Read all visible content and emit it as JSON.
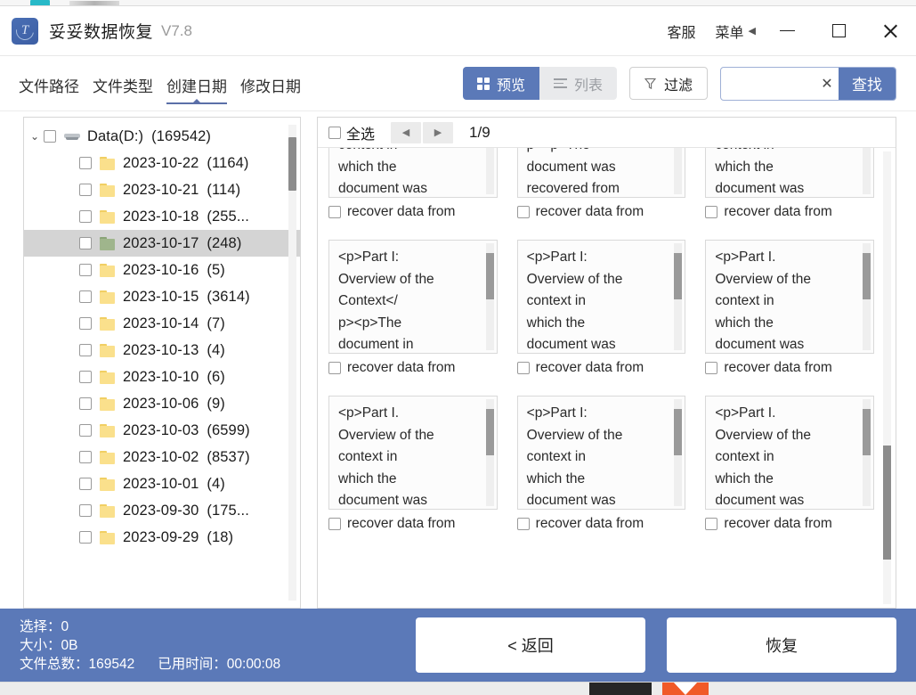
{
  "titlebar": {
    "app_name": "妥妥数据恢复",
    "version": "V7.8",
    "support_label": "客服",
    "menu_label": "菜单",
    "menu_caret": "◀",
    "minimize": "—",
    "maximize": "□",
    "close": "✕"
  },
  "toolbar": {
    "tabs": [
      {
        "label": "文件路径",
        "active": false
      },
      {
        "label": "文件类型",
        "active": false
      },
      {
        "label": "创建日期",
        "active": true
      },
      {
        "label": "修改日期",
        "active": false
      }
    ],
    "view_preview": "预览",
    "view_list": "列表",
    "filter_label": "过滤",
    "search_value": "",
    "search_placeholder": "",
    "search_clear": "✕",
    "search_button": "查找"
  },
  "tree": {
    "root": {
      "chevron": "⌄",
      "label": "Data(D:)",
      "count": "(169542)"
    },
    "items": [
      {
        "label": "2023-10-22",
        "count": "(1164)",
        "selected": false
      },
      {
        "label": "2023-10-21",
        "count": "(114)",
        "selected": false
      },
      {
        "label": "2023-10-18",
        "count": "(255...",
        "selected": false
      },
      {
        "label": "2023-10-17",
        "count": "(248)",
        "selected": true
      },
      {
        "label": "2023-10-16",
        "count": "(5)",
        "selected": false
      },
      {
        "label": "2023-10-15",
        "count": "(3614)",
        "selected": false
      },
      {
        "label": "2023-10-14",
        "count": "(7)",
        "selected": false
      },
      {
        "label": "2023-10-13",
        "count": "(4)",
        "selected": false
      },
      {
        "label": "2023-10-10",
        "count": "(6)",
        "selected": false
      },
      {
        "label": "2023-10-06",
        "count": "(9)",
        "selected": false
      },
      {
        "label": "2023-10-03",
        "count": "(6599)",
        "selected": false
      },
      {
        "label": "2023-10-02",
        "count": "(8537)",
        "selected": false
      },
      {
        "label": "2023-10-01",
        "count": "(4)",
        "selected": false
      },
      {
        "label": "2023-09-30",
        "count": "(175...",
        "selected": false
      },
      {
        "label": "2023-09-29",
        "count": "(18)",
        "selected": false
      }
    ]
  },
  "preview": {
    "select_all_label": "全选",
    "prev_arrow": "◀",
    "next_arrow": "▶",
    "page_indicator": "1/9",
    "cards": [
      {
        "text": "<p>Part I.\nOverview of the\ncontext in\nwhich the\ndocument was",
        "filename": "recover data from"
      },
      {
        "text": "<p>Part I.\nOverview</\np><p>The\ndocument was\nrecovered from",
        "filename": "recover data from"
      },
      {
        "text": "<p>Part I.\nOverview of the\ncontext in\nwhich the\ndocument was",
        "filename": "recover data from"
      },
      {
        "text": "<p>Part I:\nOverview of the\nContext</\np><p>The\ndocument in",
        "filename": "recover data from"
      },
      {
        "text": "<p>Part I:\nOverview of the\ncontext in\nwhich the\ndocument was",
        "filename": "recover data from"
      },
      {
        "text": "<p>Part I.\nOverview of the\ncontext in\nwhich the\ndocument was",
        "filename": "recover data from"
      },
      {
        "text": "<p>Part I.\nOverview of the\ncontext in\nwhich the\ndocument was",
        "filename": "recover data from"
      },
      {
        "text": "<p>Part I:\nOverview of the\ncontext in\nwhich the\ndocument was",
        "filename": "recover data from"
      },
      {
        "text": "<p>Part I.\nOverview of the\ncontext in\nwhich the\ndocument was",
        "filename": "recover data from"
      }
    ]
  },
  "footer": {
    "selected_label": "选择：",
    "selected_value": "0",
    "size_label": "大小：",
    "size_value": "0B",
    "total_label": "文件总数：",
    "total_value": "169542",
    "elapsed_label": "已用时间：",
    "elapsed_value": "00:00:08",
    "back_button": "< 返回",
    "recover_button": "恢复"
  },
  "colors": {
    "accent": "#5b79b8",
    "selected_row": "#d4d4d4",
    "folder": "#fae08c",
    "folder_selected": "#9fb58c"
  }
}
